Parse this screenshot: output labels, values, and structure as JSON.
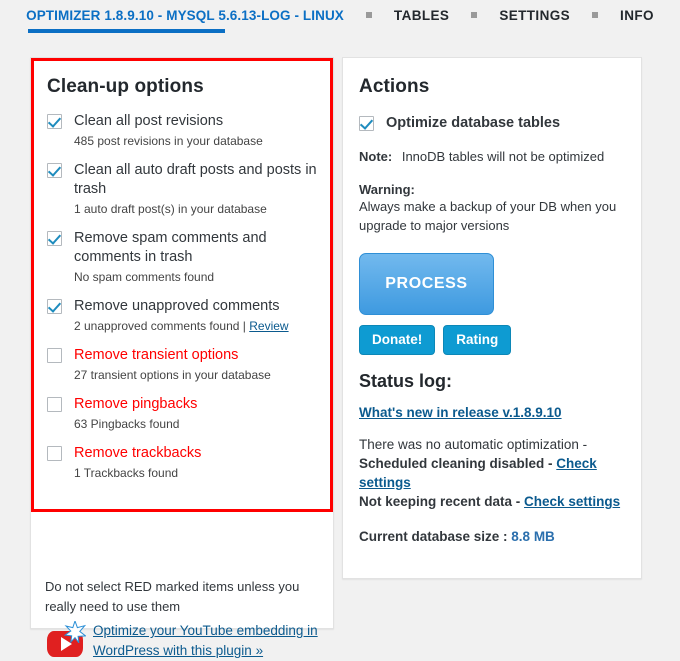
{
  "nav": {
    "title": "OPTIMIZER 1.8.9.10 - MYSQL 5.6.13-LOG - LINUX",
    "items": [
      {
        "label": "TABLES"
      },
      {
        "label": "SETTINGS"
      },
      {
        "label": "INFO"
      }
    ]
  },
  "colors": {
    "accent_blue": "#0b6fc4",
    "danger_red": "#ff0000",
    "link_blue": "#0b5a8e",
    "button_cyan": "#0e9bd2",
    "process_blue": "#3e9ae0",
    "page_bg": "#f1f1f1"
  },
  "cleanup": {
    "title": "Clean-up options",
    "options": [
      {
        "label": "Clean all post revisions",
        "sub": "485 post revisions in your database",
        "checked": true,
        "danger": false,
        "link": ""
      },
      {
        "label": "Clean all auto draft posts and posts in trash",
        "sub": "1 auto draft post(s) in your database",
        "checked": true,
        "danger": false,
        "link": ""
      },
      {
        "label": "Remove spam comments and comments in trash",
        "sub": "No spam comments found",
        "checked": true,
        "danger": false,
        "link": ""
      },
      {
        "label": "Remove unapproved comments",
        "sub": "2 unapproved comments found | ",
        "checked": true,
        "danger": false,
        "link": "Review"
      },
      {
        "label": "Remove transient options",
        "sub": "27 transient options in your database",
        "checked": false,
        "danger": true,
        "link": ""
      },
      {
        "label": "Remove pingbacks",
        "sub": "63 Pingbacks found",
        "checked": false,
        "danger": true,
        "link": ""
      },
      {
        "label": "Remove trackbacks",
        "sub": "1 Trackbacks found",
        "checked": false,
        "danger": true,
        "link": ""
      }
    ],
    "red_note": "Do not select RED marked items unless you really need to use them",
    "promo_link": "Optimize your YouTube embedding in WordPress with this plugin »",
    "promo_icon": "youtube-star-icon"
  },
  "actions": {
    "title": "Actions",
    "optimize_checkbox": {
      "label": "Optimize database tables",
      "checked": true
    },
    "note_label": "Note:",
    "note_text": "InnoDB tables will not be optimized",
    "warning_label": "Warning:",
    "warning_text": "Always make a backup of your DB when you upgrade to major versions",
    "process_label": "PROCESS",
    "donate_label": "Donate!",
    "rating_label": "Rating",
    "status_title": "Status log:",
    "whats_new": "What's new in release v.1.8.9.10",
    "log": {
      "line1": "There was no automatic optimization -",
      "line2a": "Scheduled cleaning disabled - ",
      "line2_link": "Check settings",
      "line3a": "Not keeping recent data - ",
      "line3_link": "Check settings"
    },
    "db_size_label": "Current database size : ",
    "db_size_value": "8.8 MB"
  }
}
